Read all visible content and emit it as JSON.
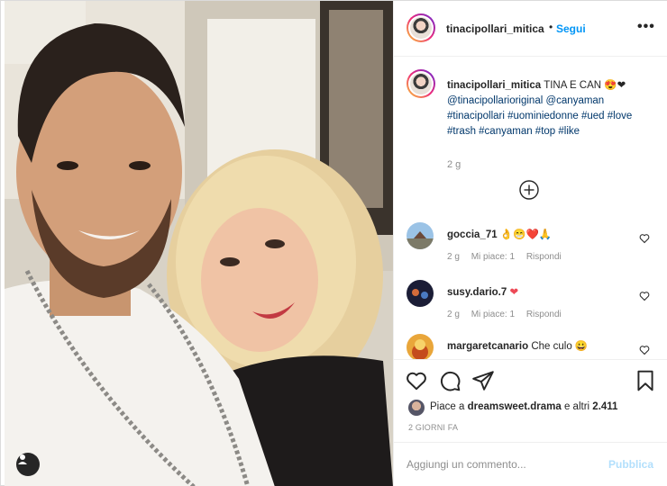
{
  "header": {
    "username": "tinacipollari_mitica",
    "separator": "•",
    "follow_label": "Segui",
    "more_label": "•••"
  },
  "caption": {
    "username": "tinacipollari_mitica",
    "text": "TINA E CAN 😍❤",
    "hashtags": "@tinacipollarioriginal @canyaman #tinacipollari #uominiedonne #ued #love #trash #canyaman #top #like",
    "time": "2 g"
  },
  "comments": [
    {
      "username": "goccia_71",
      "text": "👌😁❤️🙏",
      "time": "2 g",
      "likes": "Mi piace: 1",
      "reply": "Rispondi"
    },
    {
      "username": "susy.dario.7",
      "text": "❤",
      "time": "2 g",
      "likes": "Mi piace: 1",
      "reply": "Rispondi"
    },
    {
      "username": "margaretcanario",
      "text": "Che culo 😀"
    }
  ],
  "likes": {
    "prefix": "Piace a",
    "user": "dreamsweet.drama",
    "suffix": "e altri",
    "count": "2.411"
  },
  "date": "2 GIORNI FA",
  "add_comment": {
    "placeholder": "Aggiungi un commento...",
    "post_label": "Pubblica"
  },
  "icons": {
    "like": "heart-icon",
    "comment": "comment-icon",
    "share": "paper-plane-icon",
    "save": "bookmark-icon",
    "load_more": "plus-circle-icon",
    "user_tag": "user-tag-icon"
  },
  "colors": {
    "link": "#0095f6",
    "hashtag": "#00376b",
    "secondary": "#8e8e8e",
    "heart_red": "#ed4956",
    "publish_disabled": "#b2dffc"
  }
}
